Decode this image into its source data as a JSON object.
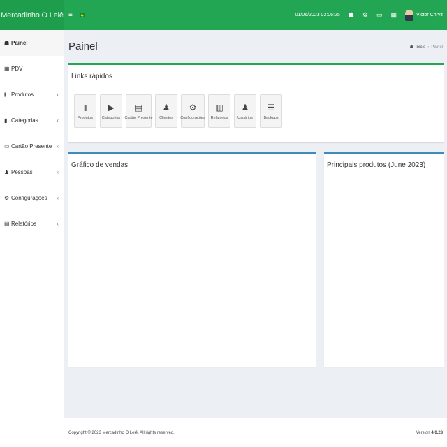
{
  "brand": "Mercadinho O Lelê",
  "header": {
    "menu_icon": "≡",
    "datetime": "01/06/2023 02:06:25",
    "icons": [
      "home-icon",
      "cogs-icon",
      "monitor-icon",
      "grid-icon"
    ],
    "user_name": "Victor Chryz"
  },
  "sidebar": {
    "items": [
      {
        "label": "Painel",
        "icon": "☗"
      },
      {
        "label": "PDV",
        "icon": "▦"
      },
      {
        "label": "Produtos",
        "icon": "|||",
        "arrow": "‹"
      },
      {
        "label": "Categorias",
        "icon": "▮",
        "arrow": "‹"
      },
      {
        "label": "Cartão Presente",
        "icon": "▭",
        "arrow": "‹"
      },
      {
        "label": "Pessoas",
        "icon": "♟",
        "arrow": "‹"
      },
      {
        "label": "Configurações",
        "icon": "⚙",
        "arrow": "‹"
      },
      {
        "label": "Relatórios",
        "icon": "▤",
        "arrow": "‹"
      }
    ]
  },
  "page": {
    "title": "Painel",
    "breadcrumb": {
      "home": "Início",
      "sep": "›",
      "current": "Painel"
    }
  },
  "quick_links": {
    "title": "Links rápidos",
    "items": [
      {
        "label": "Produtos",
        "icon": "|||"
      },
      {
        "label": "Categorias",
        "icon": "▶"
      },
      {
        "label": "Cartão Presente",
        "icon": "▤"
      },
      {
        "label": "Clientes",
        "icon": "♟"
      },
      {
        "label": "Configurações",
        "icon": "⚙"
      },
      {
        "label": "Relatórios",
        "icon": "▥"
      },
      {
        "label": "Usuários",
        "icon": "♟"
      },
      {
        "label": "Backups",
        "icon": "☰"
      }
    ]
  },
  "sales_chart": {
    "title": "Gráfico de vendas"
  },
  "top_products": {
    "title": "Principais produtos (June 2023)"
  },
  "footer": {
    "copyright": "Copyright © 2023 Mercadinho O Lelê. All rights reserved.",
    "version_label": "Version",
    "version": "4.0.28"
  },
  "colors": {
    "brand_green": "#22a654",
    "box_blue": "#3c8dbc"
  }
}
